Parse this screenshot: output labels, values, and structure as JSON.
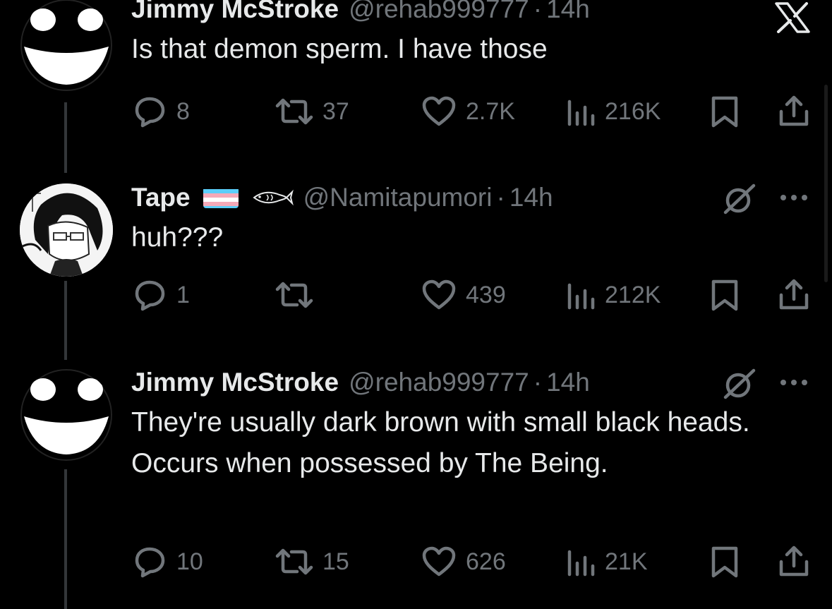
{
  "colors": {
    "background": "#000000",
    "text_primary": "#e7e9ea",
    "text_secondary": "#71767b",
    "thread_line": "#333639"
  },
  "tweets": [
    {
      "display_name": "Jimmy McStroke",
      "handle": "@rehab999777",
      "separator": "·",
      "time": "14h",
      "text": "Is that demon sperm. I have those",
      "avatar_icon": "grinning-face-avatar",
      "replies": "8",
      "retweets": "37",
      "likes": "2.7K",
      "views": "216K"
    },
    {
      "display_name": "Tape",
      "name_icons": [
        "trans-flag-icon",
        "fish-icon"
      ],
      "handle": "@Namitapumori",
      "separator": "·",
      "time": "14h",
      "text": "huh???",
      "avatar_icon": "anime-girl-avatar",
      "replies": "1",
      "retweets": "",
      "likes": "439",
      "views": "212K"
    },
    {
      "display_name": "Jimmy McStroke",
      "handle": "@rehab999777",
      "separator": "·",
      "time": "14h",
      "text": "They're usually dark brown with small black heads. Occurs when possessed by The Being.",
      "avatar_icon": "grinning-face-avatar",
      "replies": "10",
      "retweets": "15",
      "likes": "626",
      "views": "21K"
    }
  ],
  "icons": {
    "brand": "x-logo-icon",
    "grok": "grok-icon",
    "more": "more-dots-icon",
    "reply": "reply-icon",
    "retweet": "retweet-icon",
    "like": "heart-icon",
    "views": "views-icon",
    "bookmark": "bookmark-icon",
    "share": "share-icon"
  }
}
